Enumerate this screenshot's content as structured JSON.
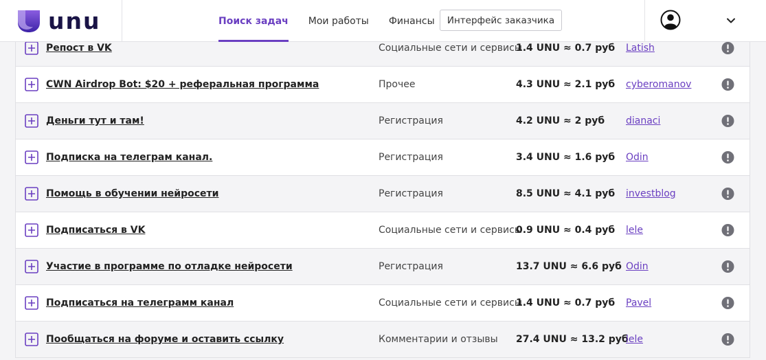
{
  "header": {
    "logo_text": "unu",
    "nav": [
      {
        "label": "Поиск задач",
        "active": true
      },
      {
        "label": "Мои работы",
        "active": false
      },
      {
        "label": "Финансы",
        "active": false
      }
    ],
    "customer_button": "Интерфейс заказчика"
  },
  "colors": {
    "accent": "#6a3fc1",
    "logo_gradient_top": "#7b4fd6",
    "logo_gradient_bottom": "#4a2db8",
    "warning_icon": "#707078"
  },
  "icons": {
    "expand": "plus-square-icon",
    "report": "exclamation-circle-icon",
    "user": "user-circle-icon",
    "dropdown": "chevron-down-icon"
  },
  "tasks": [
    {
      "title": "Репост в VK",
      "category": "Социальные сети и сервисы",
      "price": "1.4 UNU ≈ 0.7 руб",
      "author": "Latish"
    },
    {
      "title": "CWN Airdrop Bot: $20 + реферальная программа",
      "category": "Прочее",
      "price": "4.3 UNU ≈ 2.1 руб",
      "author": "cyberomanov"
    },
    {
      "title": "Деньги тут и там!",
      "category": "Регистрация",
      "price": "4.2 UNU ≈ 2 руб",
      "author": "dianaci"
    },
    {
      "title": "Подписка на телеграм канал.",
      "category": "Регистрация",
      "price": "3.4 UNU ≈ 1.6 руб",
      "author": "Odin"
    },
    {
      "title": "Помощь в обучении нейросети",
      "category": "Регистрация",
      "price": "8.5 UNU ≈ 4.1 руб",
      "author": "investblog"
    },
    {
      "title": "Подписаться в VK",
      "category": "Социальные сети и сервисы",
      "price": "0.9 UNU ≈ 0.4 руб",
      "author": "lele"
    },
    {
      "title": "Участие в программе по отладке нейросети",
      "category": "Регистрация",
      "price": "13.7 UNU ≈ 6.6 руб",
      "author": "Odin"
    },
    {
      "title": "Подписаться на телеграмм канал",
      "category": "Социальные сети и сервисы",
      "price": "1.4 UNU ≈ 0.7 руб",
      "author": "Pavel"
    },
    {
      "title": "Пообщаться на форуме и оставить ссылку",
      "category": "Комментарии и отзывы",
      "price": "27.4 UNU ≈ 13.2 руб",
      "author": "lele"
    }
  ]
}
